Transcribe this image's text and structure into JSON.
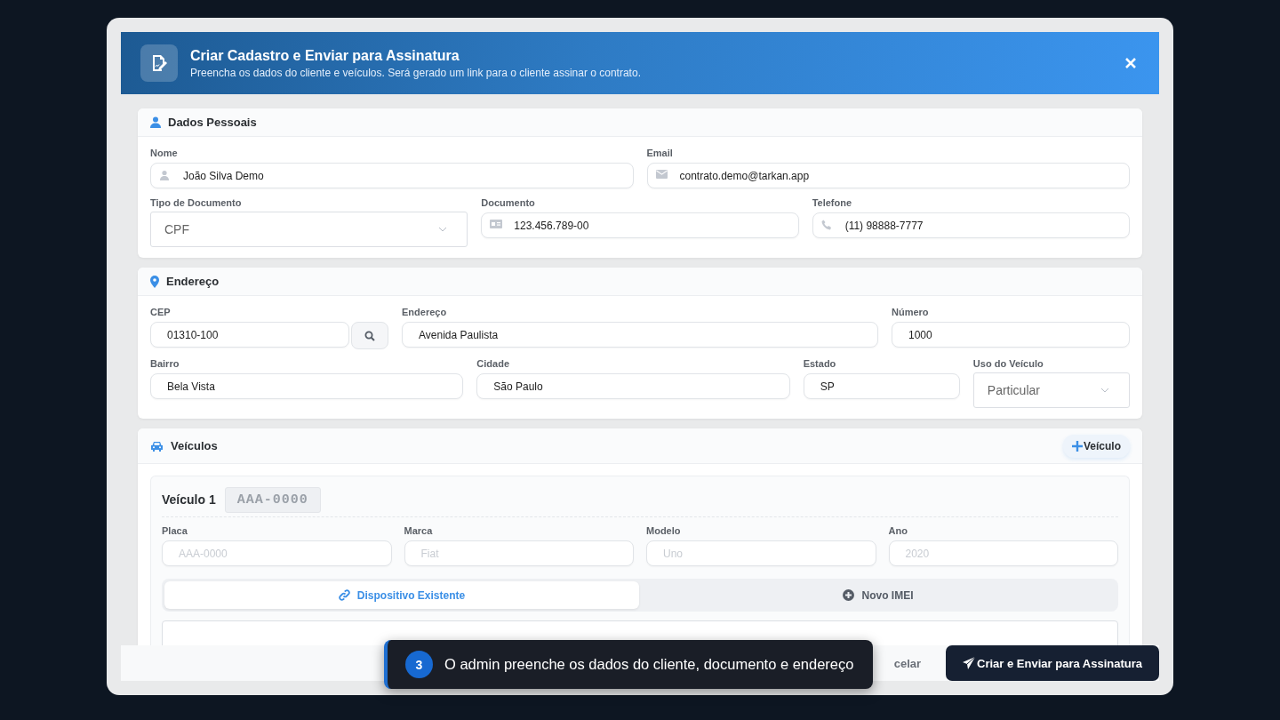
{
  "dialog": {
    "title": "Criar Cadastro e Enviar para Assinatura",
    "subtitle": "Preencha os dados do cliente e veículos. Será gerado um link para o cliente assinar o contrato."
  },
  "sections": [
    {
      "kind": "personal",
      "title": "Dados Pessoais",
      "rows": [
        [
          {
            "kind": "name",
            "label": "Nome",
            "value": "João Silva Demo"
          },
          {
            "kind": "email",
            "label": "Email",
            "value": "contrato.demo@tarkan.app"
          }
        ],
        [
          {
            "kind": "select",
            "label": "Tipo de Documento",
            "value": "CPF"
          },
          {
            "kind": "document",
            "label": "Documento",
            "value": "123.456.789-00"
          },
          {
            "kind": "phone",
            "label": "Telefone",
            "value": "(11) 98888-7777"
          }
        ]
      ]
    },
    {
      "kind": "address",
      "title": "Endereço",
      "rows": [
        [
          {
            "kind": "cep",
            "label": "CEP",
            "value": "01310-100"
          },
          {
            "kind": "plain",
            "label": "Endereço",
            "value": "Avenida Paulista"
          },
          {
            "kind": "plain",
            "label": "Número",
            "value": "1000"
          }
        ],
        [
          {
            "kind": "plain",
            "label": "Bairro",
            "value": "Bela Vista"
          },
          {
            "kind": "plain",
            "label": "Cidade",
            "value": "São Paulo"
          },
          {
            "kind": "plain",
            "label": "Estado",
            "value": "SP"
          },
          {
            "kind": "select",
            "label": "Uso do Veículo",
            "value": "Particular"
          }
        ]
      ]
    },
    {
      "kind": "vehicles",
      "title": "Veículos",
      "add_button": "Veículo",
      "vehicles": [
        {
          "title": "Veículo 1",
          "plate_badge": "AAA-0000",
          "fields": [
            {
              "label": "Placa",
              "placeholder": "AAA-0000"
            },
            {
              "label": "Marca",
              "placeholder": "Fiat"
            },
            {
              "label": "Modelo",
              "placeholder": "Uno"
            },
            {
              "label": "Ano",
              "placeholder": "2020"
            }
          ],
          "device_tabs": [
            {
              "kind": "link",
              "label": "Dispositivo Existente",
              "selected": true
            },
            {
              "kind": "add",
              "label": "Novo IMEI",
              "selected": false
            }
          ]
        }
      ]
    }
  ],
  "footer": {
    "cancel_button": "celar",
    "submit_button": "Criar e Enviar para Assinatura"
  },
  "toast": {
    "step": "3",
    "text": "O admin preenche os dados do cliente, documento e endereço"
  }
}
